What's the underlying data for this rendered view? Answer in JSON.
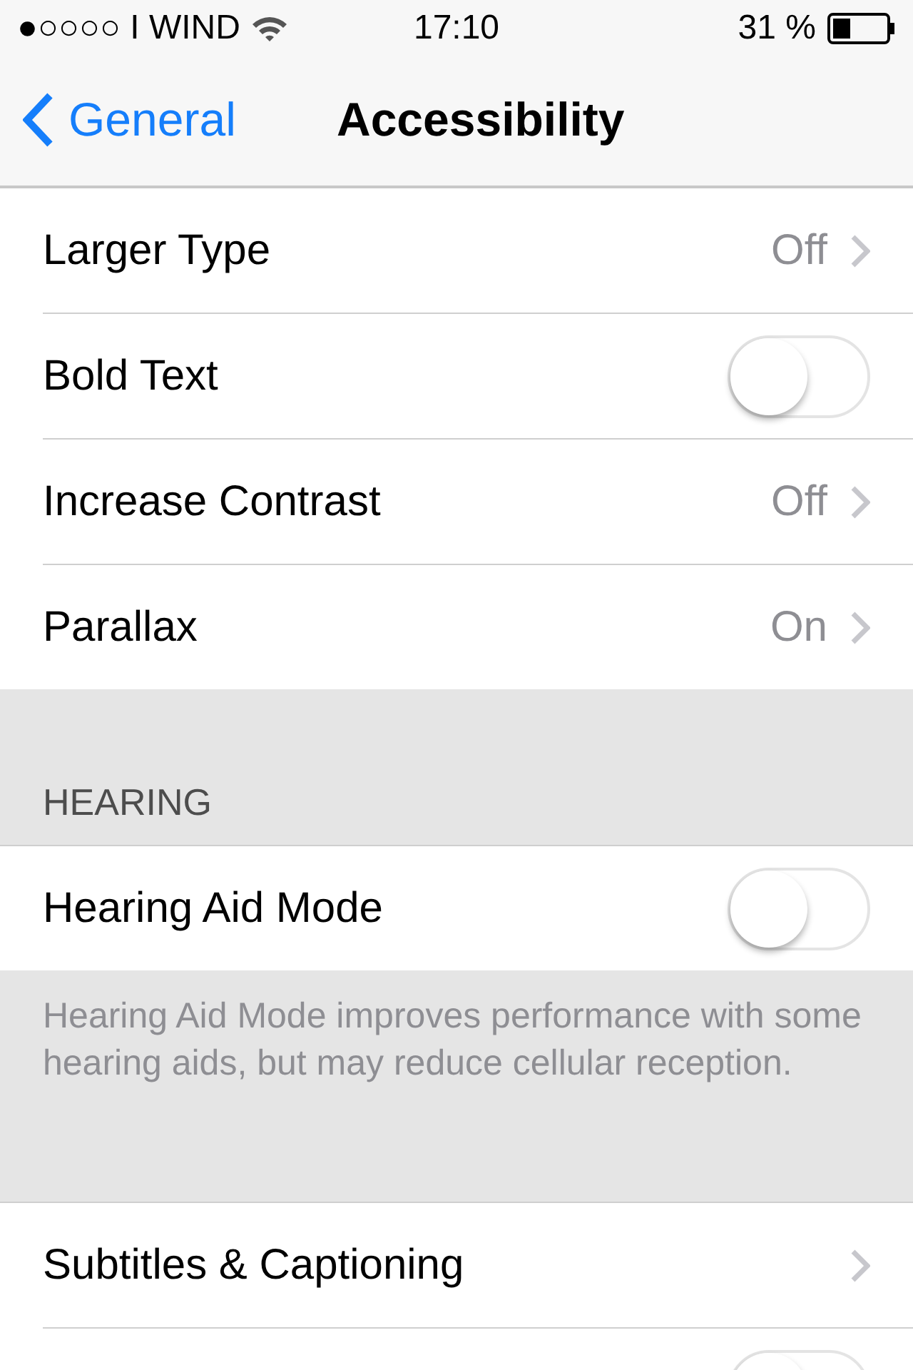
{
  "status_bar": {
    "carrier": "●○○○○ I WIND",
    "time": "17:10",
    "battery": "31 %"
  },
  "nav": {
    "back": "General",
    "title": "Accessibility"
  },
  "groups": [
    {
      "rows": [
        {
          "kind": "value",
          "label": "Larger Type",
          "value": "Off"
        },
        {
          "kind": "toggle",
          "label": "Bold Text",
          "on": false
        },
        {
          "kind": "value",
          "label": "Increase Contrast",
          "value": "Off"
        },
        {
          "kind": "value",
          "label": "Parallax",
          "value": "On"
        }
      ]
    },
    {
      "header": "HEARING",
      "rows": [
        {
          "kind": "toggle",
          "label": "Hearing Aid Mode",
          "on": false
        }
      ],
      "footer": "Hearing Aid Mode improves performance with some hearing aids, but may reduce cellular reception."
    },
    {
      "rows": [
        {
          "kind": "link",
          "label": "Subtitles & Captioning"
        },
        {
          "kind": "toggle",
          "on": false
        }
      ]
    }
  ]
}
